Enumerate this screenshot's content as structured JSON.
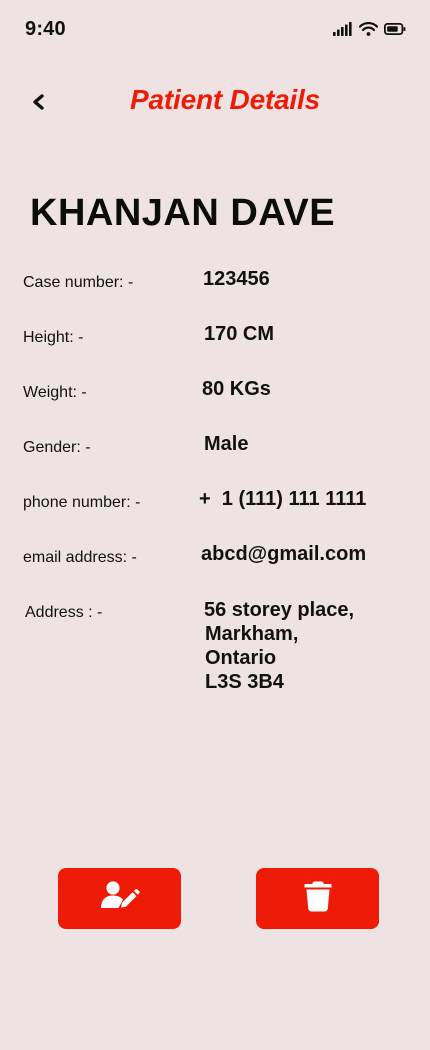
{
  "status_bar": {
    "time": "9:40",
    "icons": [
      "signal-icon",
      "wifi-icon",
      "battery-icon"
    ]
  },
  "header": {
    "back_icon": "chevron-left-icon",
    "title": "Patient Details"
  },
  "patient": {
    "name": "KHANJAN DAVE",
    "details": {
      "case_number": {
        "label": "Case number: -",
        "value": "123456"
      },
      "height": {
        "label": "Height: -",
        "value": "170 CM"
      },
      "weight": {
        "label": "Weight: -",
        "value": "80 KGs"
      },
      "gender": {
        "label": "Gender: -",
        "value": "Male"
      },
      "phone": {
        "label": "phone number: -",
        "value": "+  1 (111) 111 1111"
      },
      "email": {
        "label": "email address: -",
        "value": "abcd@gmail.com"
      },
      "address": {
        "label": "Address : -",
        "lines": [
          "56 storey place,",
          "Markham,",
          "Ontario",
          "L3S 3B4"
        ]
      }
    }
  },
  "actions": {
    "edit_icon": "user-edit-icon",
    "delete_icon": "trash-icon"
  },
  "colors": {
    "background": "#efe2e3",
    "accent": "#ee1b06",
    "text": "#111111"
  }
}
